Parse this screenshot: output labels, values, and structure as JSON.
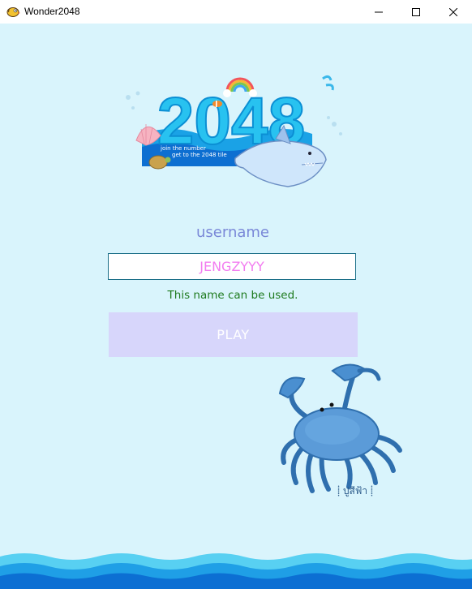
{
  "window": {
    "title": "Wonder2048",
    "icon": "bird-app-icon"
  },
  "logo": {
    "title": "2048",
    "tagline_1": "join the number",
    "tagline_2": "get to the 2048 tile"
  },
  "form": {
    "username_label": "username",
    "username_value": "JENGZYYY",
    "status": "This name can be used.",
    "play_label": "PLAY"
  },
  "decor": {
    "crab_caption": "⸽ ปูสีฟ้า ⸽"
  },
  "colors": {
    "background": "#d9f4fc",
    "label": "#7a88d8",
    "input_text": "#f27cf0",
    "status_ok": "#1e7a1e",
    "play_bg": "#d7d6fb"
  }
}
